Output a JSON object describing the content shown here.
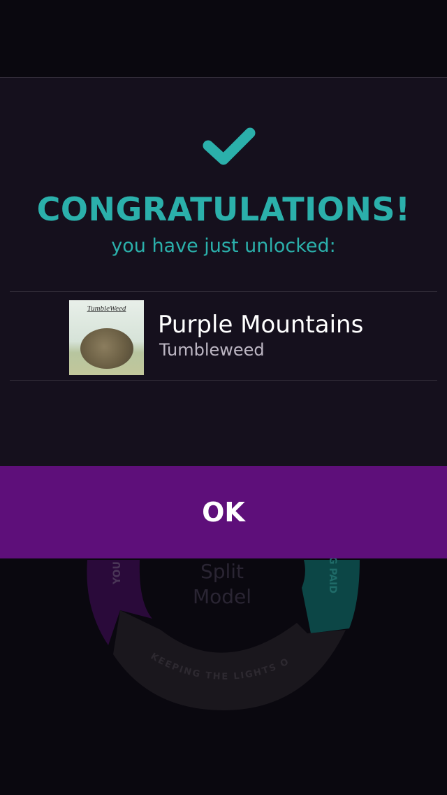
{
  "modal": {
    "title": "CONGRATULATIONS!",
    "subtitle": "you have just unlocked:",
    "track": {
      "title": "Purple Mountains",
      "artist": "Tumbleweed",
      "art_caption": "TumbleWeed"
    },
    "ok_label": "OK"
  },
  "background": {
    "center_line1": "Split",
    "center_line2": "Model",
    "segments": [
      "YOU",
      "G PAID",
      "KEEPING THE LIGHTS ON"
    ]
  },
  "colors": {
    "accent": "#2bb0ab",
    "button": "#5e0f7a",
    "panel": "#15101d",
    "background": "#0a080f"
  }
}
